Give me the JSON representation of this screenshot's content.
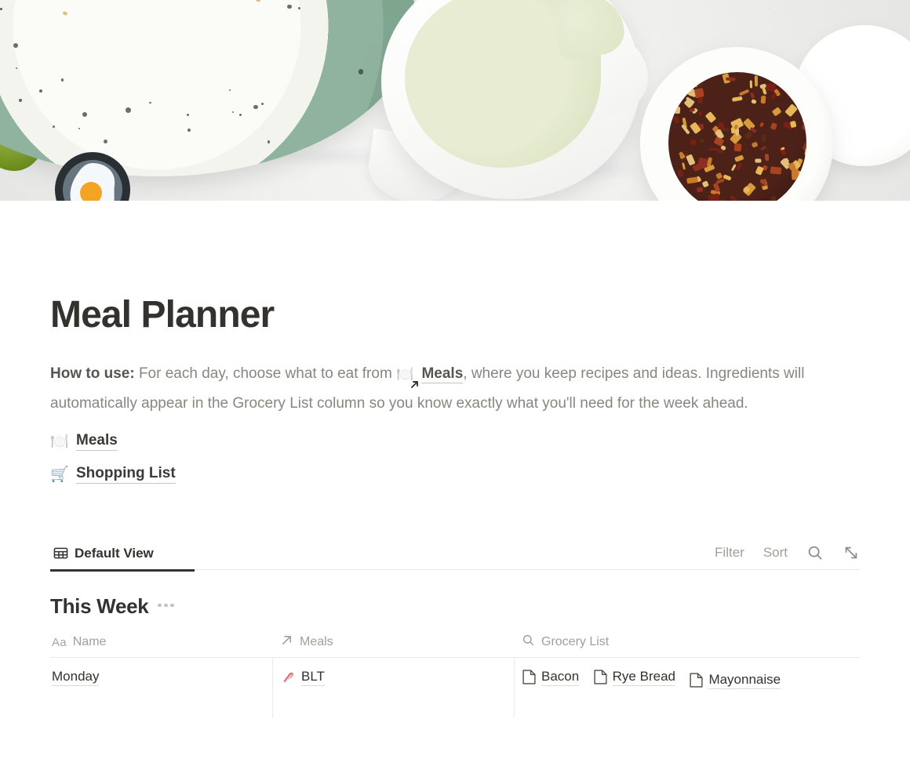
{
  "cover": {
    "alt": "Yogurt bowl with kiwi, strawberry and blueberries, a white pitcher of pale green liquid and a bowl of dried tea on marble"
  },
  "page": {
    "icon": "fried-egg-in-pan",
    "icon_emoji": "🍳",
    "title": "Meal Planner"
  },
  "description": {
    "lead_label": "How to use:",
    "part1": " For each day, choose what to eat from ",
    "meals_emoji": "🍽️",
    "meals_link": "Meals",
    "part2": ", where you keep recipes and ideas. Ingredients will automatically appear in the Grocery List column so you know exactly what you'll need for the week ahead."
  },
  "page_links": [
    {
      "emoji": "🍽️",
      "label": "Meals",
      "icon": "plate-with-cutlery-icon"
    },
    {
      "emoji": "🛒",
      "label": "Shopping List",
      "icon": "shopping-cart-icon"
    }
  ],
  "database": {
    "tabs": [
      {
        "label": "Default View",
        "icon": "table-view-icon",
        "active": true
      }
    ],
    "toolbar": {
      "filter_label": "Filter",
      "sort_label": "Sort",
      "search_icon": "search-icon",
      "expand_icon": "expand-diagonal-icon"
    },
    "group": {
      "title": "This Week",
      "more_icon": "ellipsis-icon"
    },
    "columns": [
      {
        "key": "name",
        "label": "Name",
        "type_icon": "title-aa-icon",
        "type_glyph": "Aa"
      },
      {
        "key": "meals",
        "label": "Meals",
        "type_icon": "relation-arrow-icon"
      },
      {
        "key": "grocery",
        "label": "Grocery List",
        "type_icon": "rollup-search-icon"
      }
    ],
    "rows": [
      {
        "name": "Monday",
        "meals": [
          {
            "emoji": "🥓",
            "label": "BLT"
          }
        ],
        "grocery": [
          {
            "icon": "page-icon",
            "label": "Bacon"
          },
          {
            "icon": "page-icon",
            "label": "Rye Bread"
          },
          {
            "icon": "page-icon",
            "label": "Mayonnaise"
          }
        ]
      }
    ]
  },
  "colors": {
    "text": "#33322e",
    "muted": "#87867f",
    "placeholder": "#a09f99",
    "rule": "#eceae6",
    "accent_underline": "#33322e"
  }
}
